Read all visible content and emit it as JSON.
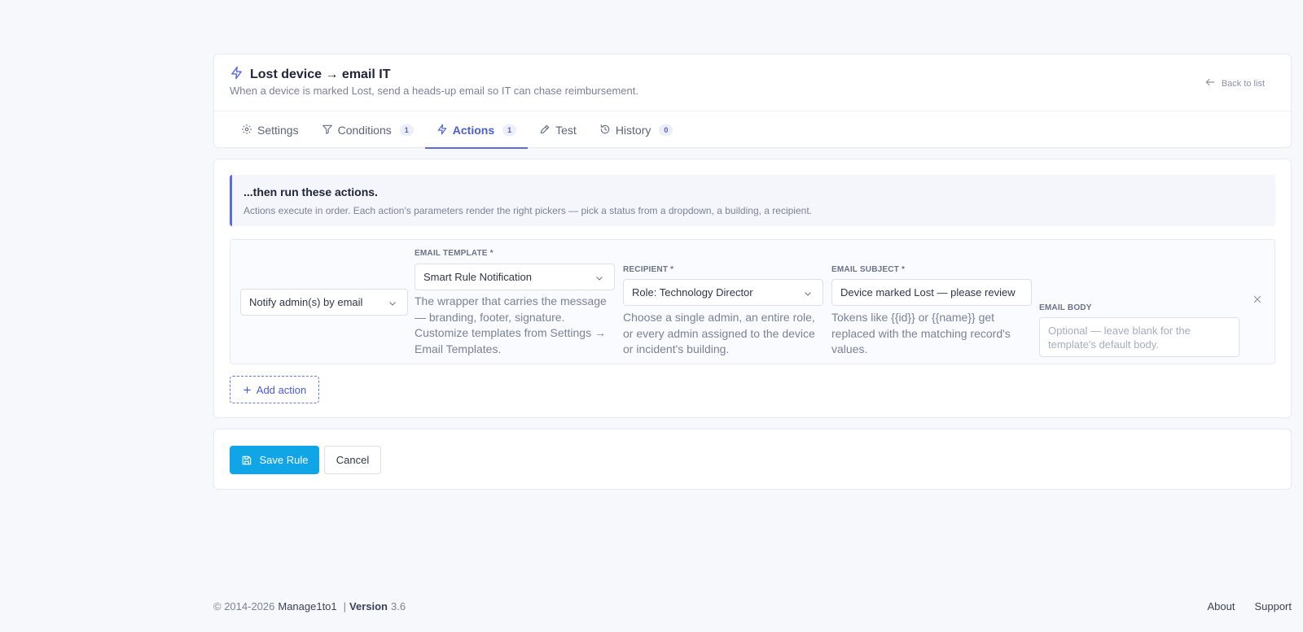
{
  "header": {
    "title": "Lost device → email IT",
    "subtitle": "When a device is marked Lost, send a heads-up email so IT can chase reimbursement.",
    "back_label": "Back to list"
  },
  "tabs": [
    {
      "label": "Settings",
      "icon": "gear-icon",
      "badge": ""
    },
    {
      "label": "Conditions",
      "icon": "filter-icon",
      "badge": "1"
    },
    {
      "label": "Actions",
      "icon": "bolt-icon",
      "badge": "1",
      "active": true
    },
    {
      "label": "Test",
      "icon": "pencil-icon",
      "badge": ""
    },
    {
      "label": "History",
      "icon": "history-icon",
      "badge": "0"
    }
  ],
  "callout": {
    "title": "...then run these actions.",
    "description": "Actions execute in order. Each action's parameters render the right pickers — pick a status from a dropdown, a building, a recipient."
  },
  "action": {
    "type_value": "Notify admin(s) by email",
    "template": {
      "label": "EMAIL TEMPLATE *",
      "value": "Smart Rule Notification",
      "help": "The wrapper that carries the message — branding, footer, signature. Customize templates from Settings → Email Templates."
    },
    "recipient": {
      "label": "RECIPIENT *",
      "value": "Role: Technology Director",
      "help": "Choose a single admin, an entire role, or every admin assigned to the device or incident's building."
    },
    "subject": {
      "label": "EMAIL SUBJECT *",
      "value": "Device marked Lost — please review",
      "help": "Tokens like {{id}} or {{name}} get replaced with the matching record's values."
    },
    "body": {
      "label": "EMAIL BODY",
      "placeholder": "Optional — leave blank for the template's default body."
    }
  },
  "add_action_label": "Add action",
  "buttons": {
    "save": "Save Rule",
    "cancel": "Cancel"
  },
  "footer": {
    "copyright": "© 2014-2026",
    "brand": "Manage1to1",
    "separator": "|",
    "version_label": "Version",
    "version": "3.6",
    "links": [
      "About",
      "Support"
    ]
  },
  "colors": {
    "accent": "#5b6be0",
    "primary_button": "#10a5e6",
    "background": "#f7f8fc"
  }
}
